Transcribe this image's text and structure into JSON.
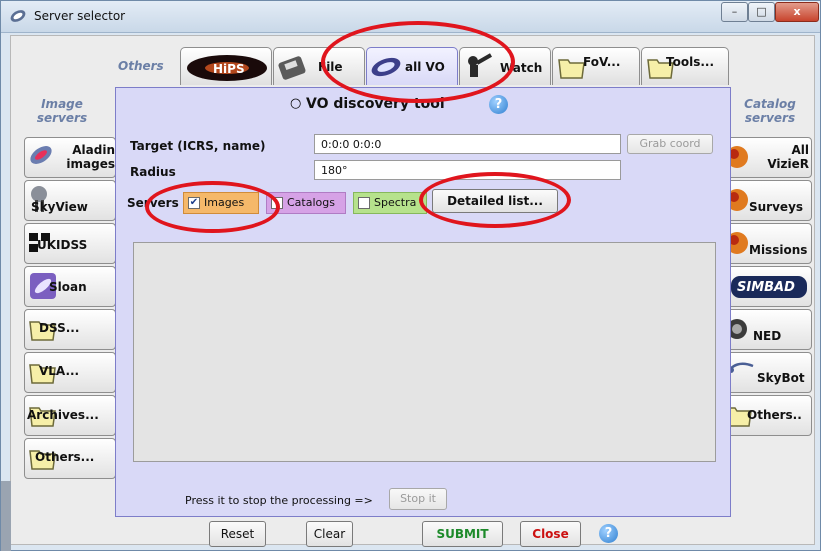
{
  "window": {
    "title": "Server selector",
    "controls": {
      "minimize": "–",
      "maximize": "□",
      "close": "x"
    }
  },
  "left_column": {
    "heading": "Image servers",
    "buttons": [
      {
        "label": "Aladin images",
        "icon": "aladin-icon"
      },
      {
        "label": "SkyView",
        "icon": "telescope-icon"
      },
      {
        "label": "UKIDSS",
        "icon": "ukidss-icon"
      },
      {
        "label": "Sloan",
        "icon": "sloan-icon"
      },
      {
        "label": "DSS...",
        "icon": "folder-icon"
      },
      {
        "label": "VLA...",
        "icon": "folder-icon"
      },
      {
        "label": "Archives...",
        "icon": "folder-icon"
      },
      {
        "label": "Others...",
        "icon": "folder-icon"
      }
    ]
  },
  "right_column": {
    "heading": "Catalog servers",
    "buttons": [
      {
        "label": "All VizieR",
        "icon": "vizier-icon"
      },
      {
        "label": "Surveys",
        "icon": "vizier-icon"
      },
      {
        "label": "Missions",
        "icon": "vizier-icon"
      },
      {
        "label": "SIMBAD",
        "icon": "simbad-logo"
      },
      {
        "label": "NED",
        "icon": "ned-icon"
      },
      {
        "label": "SkyBot",
        "icon": "imcce-logo"
      },
      {
        "label": "Others..",
        "icon": "folder-icon"
      }
    ]
  },
  "tabs": {
    "group_label": "Others",
    "items": [
      {
        "label": "HiPS",
        "icon": "hips-icon"
      },
      {
        "label": "File",
        "icon": "disk-icon"
      },
      {
        "label": "all VO",
        "icon": "vo-icon"
      },
      {
        "label": "Watch",
        "icon": "watch-icon"
      },
      {
        "label": "FoV...",
        "icon": "folder-icon"
      },
      {
        "label": "Tools...",
        "icon": "folder-icon"
      }
    ],
    "active": "all VO"
  },
  "panel": {
    "title": "VO discovery tool",
    "target_label": "Target (ICRS, name)",
    "target_value": "0:0:0 0:0:0",
    "grab_coord": "Grab coord",
    "radius_label": "Radius",
    "radius_value": "180°",
    "servers_label": "Servers",
    "filters": [
      {
        "label": "Images",
        "checked": true,
        "bg": "#f5b86a"
      },
      {
        "label": "Catalogs",
        "checked": false,
        "bg": "#d6a2e6"
      },
      {
        "label": "Spectra",
        "checked": false,
        "bg": "#b6e28c"
      }
    ],
    "detailed_list": "Detailed list...",
    "stop_text": "Press it to stop the processing =>",
    "stop_button": "Stop it"
  },
  "bottom": {
    "reset": "Reset",
    "clear": "Clear",
    "submit": "SUBMIT",
    "close": "Close"
  },
  "colors": {
    "panel_bg": "#d9d9f7",
    "heading": "#6b7fa6",
    "submit": "#1d8a2a",
    "close": "#cc1111",
    "highlight": "#e0151d"
  }
}
